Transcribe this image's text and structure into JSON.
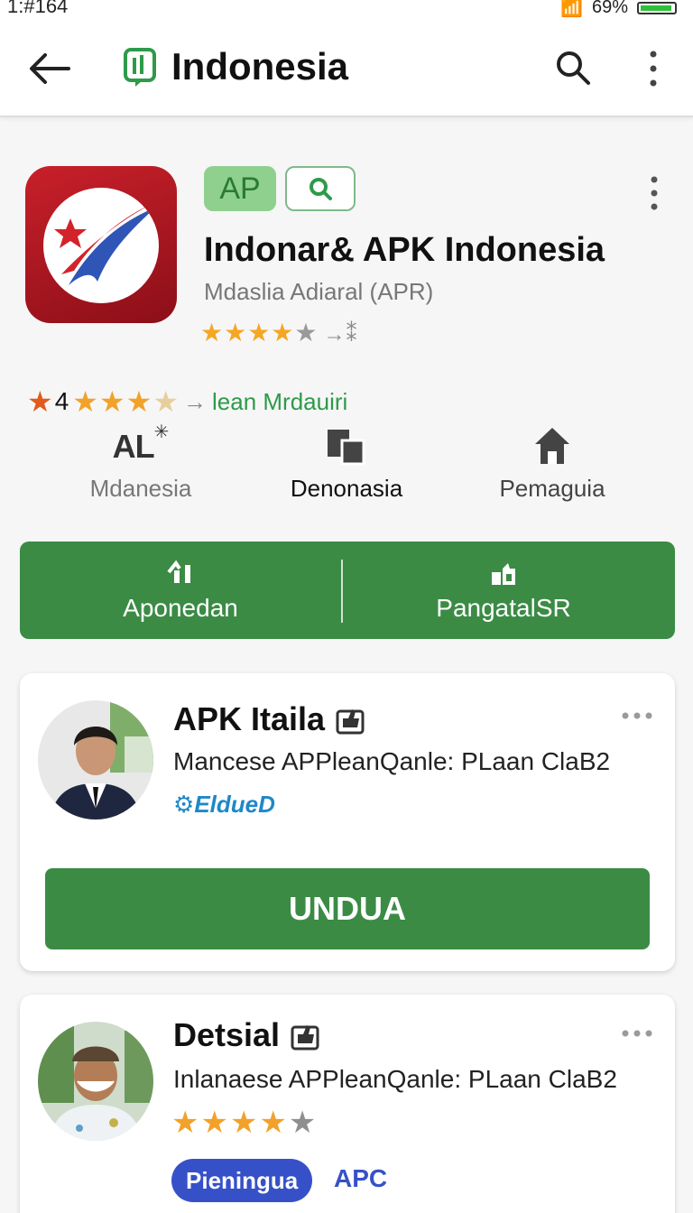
{
  "status_bar": {
    "time": "1:#164",
    "battery_text": "69%"
  },
  "app_bar": {
    "title": "Indonesia"
  },
  "app": {
    "badge": "AP",
    "title": "Indonar& APK Indonesia",
    "subtitle": "Mdaslia Adiaral  (APR)",
    "stars_filled": 4,
    "stars_total": 5,
    "stars_tail": "→⁑"
  },
  "rating_row": {
    "number": "4",
    "link": "lean Mrdauiri"
  },
  "info_columns": [
    {
      "icon": "al-text-icon",
      "icon_text": "AL",
      "label": "Mdanesia"
    },
    {
      "icon": "squares-icon",
      "label": "Denonasia"
    },
    {
      "icon": "home-icon",
      "label": "Pemaguia"
    }
  ],
  "action_bar": {
    "left_label": "Aponedan",
    "right_label": "PangatalSR"
  },
  "cards": [
    {
      "title": "APK Itaila",
      "description": "Mancese APPleanQanle: PLaan ClaB2",
      "verified": "EldueD",
      "button": "UNDUA"
    },
    {
      "title": "Detsial",
      "description": "Inlanaese APPleanQanle: PLaan ClaB2",
      "stars_filled": 4,
      "pill": "Pieningua",
      "tag": "APC"
    }
  ],
  "colors": {
    "accent_green": "#3b8b45",
    "link_green": "#2e9a4a",
    "star": "#f2a22a",
    "pill_blue": "#3651c8",
    "icon_red": "#c8202a"
  }
}
